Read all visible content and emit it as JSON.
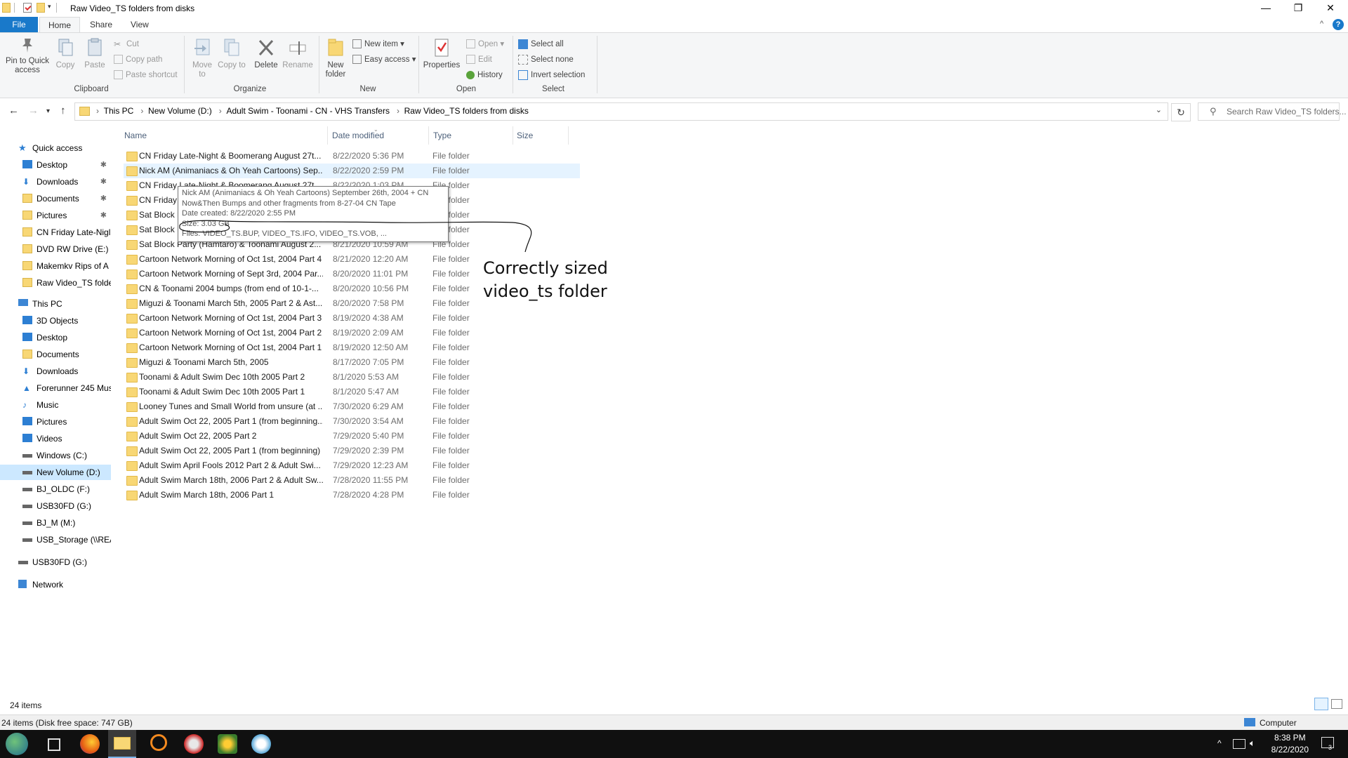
{
  "window": {
    "title": "Raw Video_TS folders from disks",
    "min": "—",
    "max": "❐",
    "close": "✕"
  },
  "tabs": {
    "file": "File",
    "home": "Home",
    "share": "Share",
    "view": "View"
  },
  "ribbon": {
    "clipboard": {
      "pin": "Pin to Quick access",
      "copy": "Copy",
      "paste": "Paste",
      "cut": "Cut",
      "copy_path": "Copy path",
      "paste_shortcut": "Paste shortcut",
      "group": "Clipboard"
    },
    "organize": {
      "move_to": "Move to",
      "copy_to": "Copy to",
      "delete": "Delete",
      "rename": "Rename",
      "group": "Organize"
    },
    "new": {
      "new_folder": "New folder",
      "new_item": "New item",
      "easy_access": "Easy access",
      "group": "New"
    },
    "open": {
      "properties": "Properties",
      "open": "Open",
      "edit": "Edit",
      "history": "History",
      "group": "Open"
    },
    "select": {
      "select_all": "Select all",
      "select_none": "Select none",
      "invert": "Invert selection",
      "group": "Select"
    }
  },
  "address": {
    "crumbs": [
      "This PC",
      "New Volume (D:)",
      "Adult Swim - Toonami - CN - VHS Transfers",
      "Raw Video_TS folders from disks"
    ],
    "search_placeholder": "Search Raw Video_TS folders..."
  },
  "nav": {
    "quick_access": "Quick access",
    "quick": [
      {
        "label": "Desktop",
        "pinned": true
      },
      {
        "label": "Downloads",
        "pinned": true
      },
      {
        "label": "Documents",
        "pinned": true
      },
      {
        "label": "Pictures",
        "pinned": true
      },
      {
        "label": "CN Friday Late-Nigl"
      },
      {
        "label": "DVD RW Drive (E:)"
      },
      {
        "label": "Makemkv Rips of A"
      },
      {
        "label": "Raw Video_TS folde"
      }
    ],
    "this_pc": "This PC",
    "pc": [
      "3D Objects",
      "Desktop",
      "Documents",
      "Downloads",
      "Forerunner 245 Mus",
      "Music",
      "Pictures",
      "Videos",
      "Windows (C:)",
      "New Volume (D:)",
      "BJ_OLDC (F:)",
      "USB30FD (G:)",
      "BJ_M (M:)",
      "USB_Storage (\\\\REA"
    ],
    "usb": "USB30FD (G:)",
    "network": "Network"
  },
  "columns": {
    "name": "Name",
    "date": "Date modified",
    "type": "Type",
    "size": "Size"
  },
  "files": [
    {
      "name": "CN Friday Late-Night & Boomerang August 27t...",
      "date": "8/22/2020 5:36 PM",
      "type": "File folder"
    },
    {
      "name": "Nick AM (Animaniacs & Oh Yeah Cartoons) Sep...",
      "date": "8/22/2020 2:59 PM",
      "type": "File folder"
    },
    {
      "name": "CN Friday Late-Night & Boomerang August 27t...",
      "date": "8/22/2020 1:03 PM",
      "type": "File folder"
    },
    {
      "name": "CN Friday",
      "date": "",
      "type": "File folder"
    },
    {
      "name": "Sat Block P",
      "date": "",
      "type": "File folder"
    },
    {
      "name": "Sat Block P",
      "date": "",
      "type": "File folder"
    },
    {
      "name": "Sat Block Party (Hamtaro) & Toonami August 2...",
      "date": "8/21/2020 10:59 AM",
      "type": "File folder"
    },
    {
      "name": "Cartoon Network Morning of Oct 1st, 2004 Part 4",
      "date": "8/21/2020 12:20 AM",
      "type": "File folder"
    },
    {
      "name": "Cartoon Network Morning of Sept 3rd, 2004 Par...",
      "date": "8/20/2020 11:01 PM",
      "type": "File folder"
    },
    {
      "name": "CN & Toonami 2004 bumps (from end of 10-1-...",
      "date": "8/20/2020 10:56 PM",
      "type": "File folder"
    },
    {
      "name": "Miguzi & Toonami March 5th, 2005 Part 2 & Ast...",
      "date": "8/20/2020 7:58 PM",
      "type": "File folder"
    },
    {
      "name": "Cartoon Network Morning of Oct 1st, 2004 Part 3",
      "date": "8/19/2020 4:38 AM",
      "type": "File folder"
    },
    {
      "name": "Cartoon Network Morning of Oct 1st, 2004 Part 2",
      "date": "8/19/2020 2:09 AM",
      "type": "File folder"
    },
    {
      "name": "Cartoon Network Morning of Oct 1st, 2004 Part 1",
      "date": "8/19/2020 12:50 AM",
      "type": "File folder"
    },
    {
      "name": "Miguzi & Toonami March 5th, 2005",
      "date": "8/17/2020 7:05 PM",
      "type": "File folder"
    },
    {
      "name": "Toonami & Adult Swim Dec 10th 2005 Part 2",
      "date": "8/1/2020 5:53 AM",
      "type": "File folder"
    },
    {
      "name": "Toonami & Adult Swim Dec 10th 2005 Part 1",
      "date": "8/1/2020 5:47 AM",
      "type": "File folder"
    },
    {
      "name": "Looney Tunes and Small World from unsure (at ...",
      "date": "7/30/2020 6:29 AM",
      "type": "File folder"
    },
    {
      "name": "Adult Swim Oct 22, 2005 Part 1 (from beginning...",
      "date": "7/30/2020 3:54 AM",
      "type": "File folder"
    },
    {
      "name": "Adult Swim Oct 22, 2005 Part 2",
      "date": "7/29/2020 5:40 PM",
      "type": "File folder"
    },
    {
      "name": "Adult Swim Oct 22, 2005 Part 1 (from beginning)",
      "date": "7/29/2020 2:39 PM",
      "type": "File folder"
    },
    {
      "name": "Adult Swim April Fools 2012 Part 2 & Adult Swi...",
      "date": "7/29/2020 12:23 AM",
      "type": "File folder"
    },
    {
      "name": "Adult Swim March 18th, 2006 Part 2 & Adult Sw...",
      "date": "7/28/2020 11:55 PM",
      "type": "File folder"
    },
    {
      "name": "Adult Swim March 18th, 2006 Part 1",
      "date": "7/28/2020 4:28 PM",
      "type": "File folder"
    }
  ],
  "tooltip": {
    "line1": "Nick AM (Animaniacs & Oh Yeah Cartoons) September 26th, 2004 + CN",
    "line2": "Now&Then Bumps and other fragments from 8-27-04 CN Tape",
    "line3": "Date created: 8/22/2020 2:55 PM",
    "line4": "Size: 3.03 GB",
    "line5": "Files: VIDEO_TS.BUP, VIDEO_TS.IFO, VIDEO_TS.VOB, ..."
  },
  "annotation": {
    "line1": "Correctly sized",
    "line2": "video_ts folder"
  },
  "status": {
    "items": "24 items",
    "disk": "24 items (Disk free space: 747 GB)",
    "computer": "Computer"
  },
  "taskbar": {
    "time": "8:38 PM",
    "date": "8/22/2020",
    "notif_count": "3"
  },
  "colors": {
    "accent": "#1979ca",
    "folder": "#f8d775",
    "selection": "#cce8ff",
    "hover": "#e5f3ff"
  }
}
